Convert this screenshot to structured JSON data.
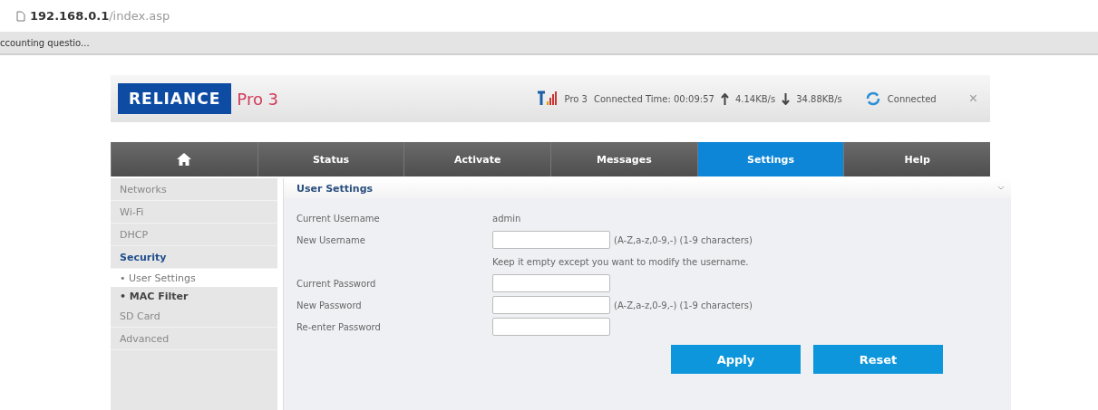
{
  "browser": {
    "address_host": "192.168.0.1",
    "address_path": "/index.asp",
    "status_text": "ccounting questio..."
  },
  "header": {
    "logo": "RELIANCE",
    "model": "Pro 3",
    "device": "Pro 3",
    "connected_time": "Connected Time: 00:09:57",
    "upload": "4.14KB/s",
    "download": "34.88KB/s",
    "connection": "Connected",
    "close": "×"
  },
  "nav": [
    {
      "kind": "home",
      "selected": false
    },
    {
      "label": "Status",
      "selected": false
    },
    {
      "label": "Activate",
      "selected": false
    },
    {
      "label": "Messages",
      "selected": false
    },
    {
      "label": "Settings",
      "selected": true
    },
    {
      "label": "Help",
      "selected": false
    }
  ],
  "sidebar": {
    "items": [
      {
        "label": "Networks",
        "selected": false
      },
      {
        "label": "Wi-Fi",
        "selected": false
      },
      {
        "label": "DHCP",
        "selected": false
      },
      {
        "label": "Security",
        "selected": true,
        "children": [
          {
            "label": "• User Settings",
            "selected": true
          },
          {
            "label": "• MAC Filter",
            "selected": false
          }
        ]
      },
      {
        "label": "SD Card",
        "selected": false
      },
      {
        "label": "Advanced",
        "selected": false
      }
    ]
  },
  "panel": {
    "title": "User Settings",
    "rows": [
      {
        "kind": "text",
        "label": "Current Username",
        "value": "admin"
      },
      {
        "kind": "input",
        "label": "New Username",
        "hint": "(A-Z,a-z,0-9,-) (1-9 characters)"
      },
      {
        "kind": "note",
        "text": "Keep it empty except you want to modify the username."
      },
      {
        "kind": "input",
        "label": "Current Password"
      },
      {
        "kind": "input",
        "label": "New Password",
        "hint": "(A-Z,a-z,0-9,-) (1-9 characters)"
      },
      {
        "kind": "input",
        "label": "Re-enter Password"
      }
    ],
    "buttons": [
      "Apply",
      "Reset"
    ]
  }
}
